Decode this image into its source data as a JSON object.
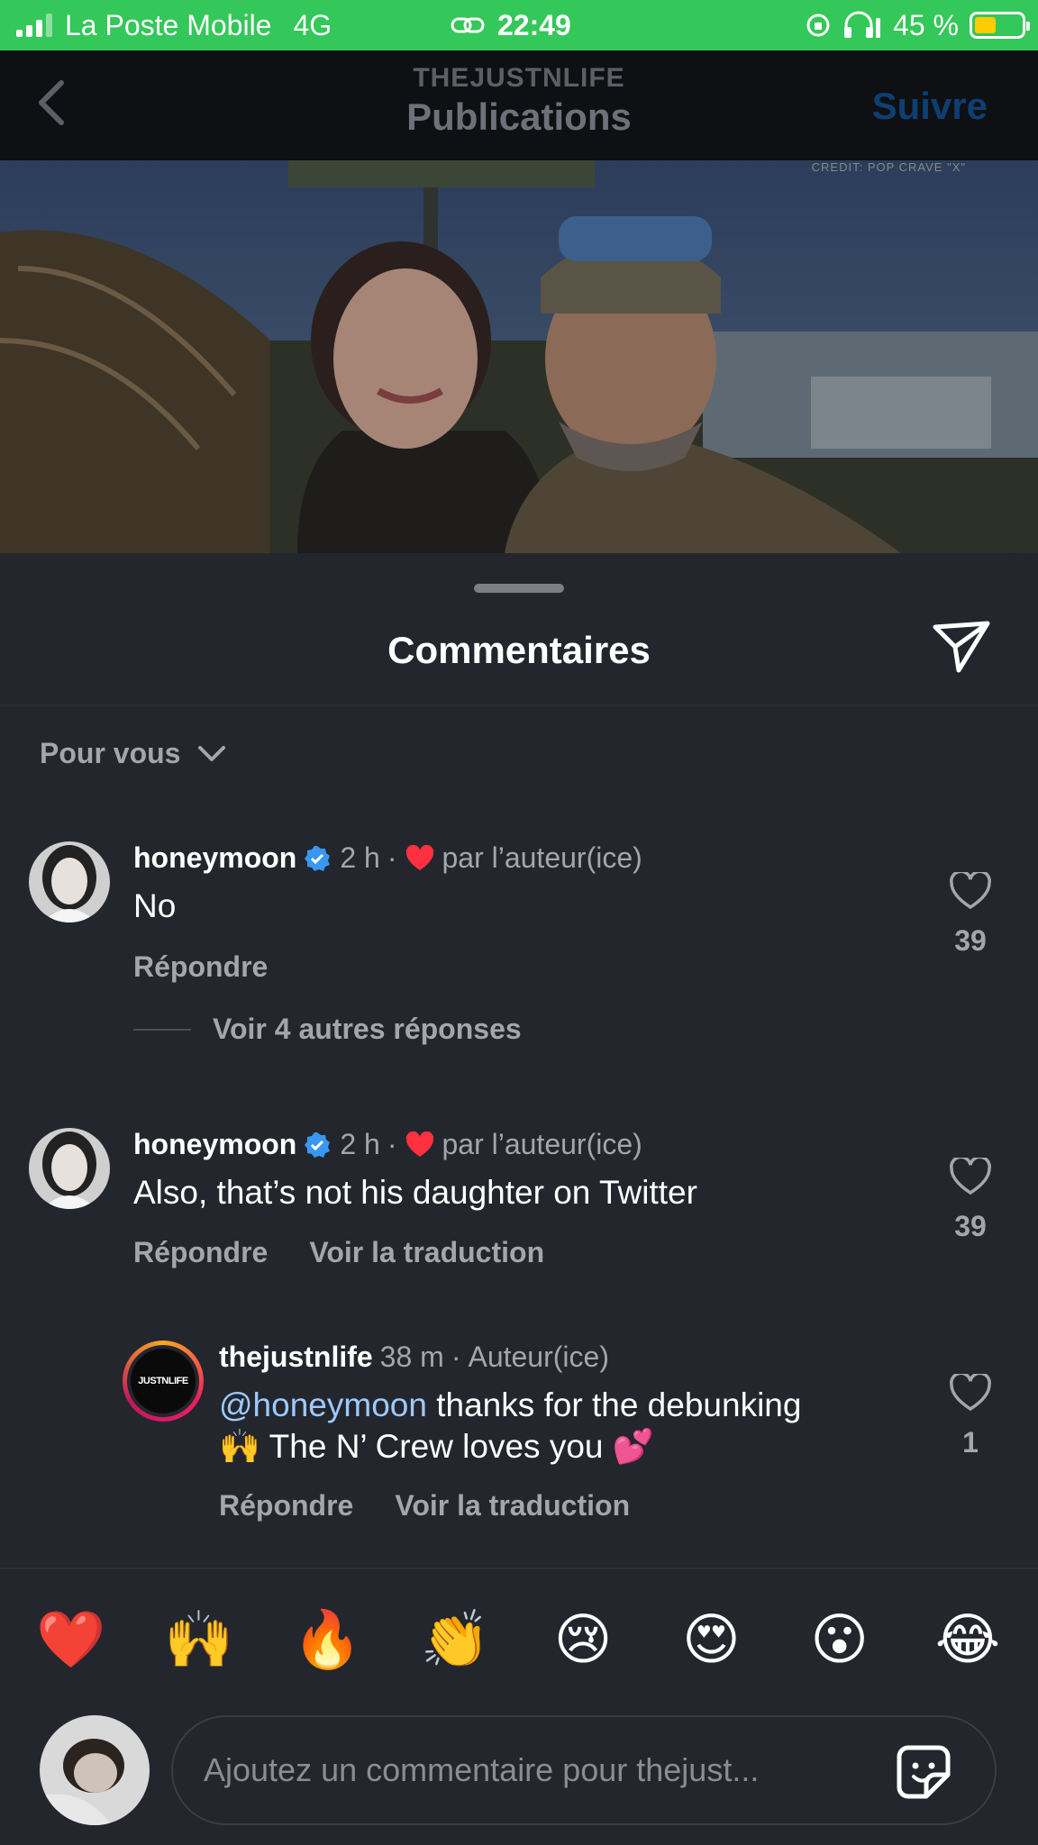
{
  "status_bar": {
    "carrier": "La Poste Mobile",
    "network": "4G",
    "time": "22:49",
    "battery": "45 %",
    "battery_level": 0.45,
    "battery_color": "#ffcc00",
    "bar_color": "#34c759"
  },
  "header": {
    "account": "THEJUSTNLIFE",
    "title": "Publications",
    "follow_label": "Suivre",
    "back_icon": "chevron-left-icon"
  },
  "photo": {
    "credit": "CREDIT: POP CRAVE \"X\""
  },
  "sheet": {
    "title": "Commentaires",
    "share_icon": "paper-plane-icon",
    "filter_label": "Pour vous"
  },
  "comments": [
    {
      "user": "honeymoon",
      "verified": true,
      "time": "2 h",
      "separator": "·",
      "liked_by_author": "par l’auteur(ice)",
      "text": "No",
      "reply_label": "Répondre",
      "likes": "39"
    },
    {
      "user": "honeymoon",
      "verified": true,
      "time": "2 h",
      "separator": "·",
      "liked_by_author": "par l’auteur(ice)",
      "text": "Also, that’s not his daughter on Twitter",
      "reply_label": "Répondre",
      "translate_label": "Voir la traduction",
      "likes": "39"
    }
  ],
  "more_replies_label": "Voir 4 autres réponses",
  "reply": {
    "user": "thejustnlife",
    "time": "38 m",
    "separator": "·",
    "role": "Auteur(ice)",
    "avatar_text": "JUSTNLIFE",
    "mention": "@honeymoon",
    "text_line1": " thanks for the debunking",
    "text_line2": "🙌 The N’ Crew loves you 💕",
    "reply_label": "Répondre",
    "translate_label": "Voir la traduction",
    "likes": "1"
  },
  "emojis": [
    "❤️",
    "🙌",
    "🔥",
    "👏",
    "😢",
    "😍",
    "😮",
    "😂"
  ],
  "composer": {
    "placeholder": "Ajoutez un commentaire pour thejust...",
    "sticker_icon": "sticker-icon"
  }
}
